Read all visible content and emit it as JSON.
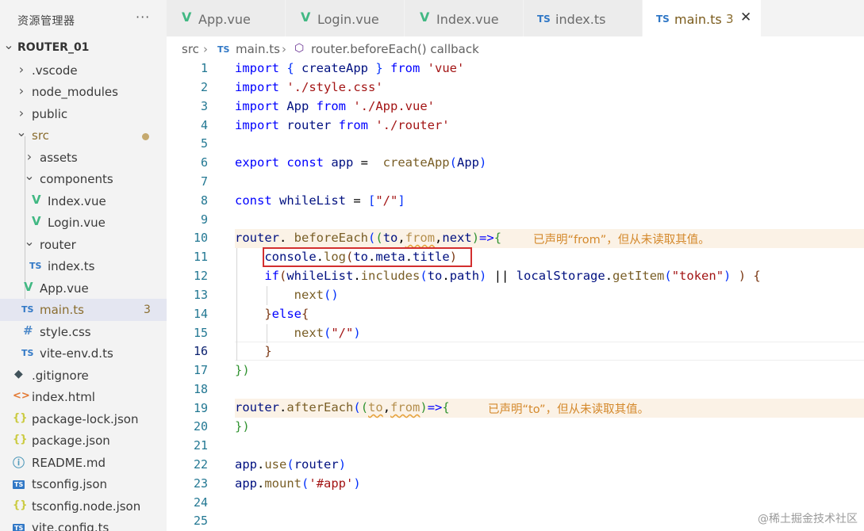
{
  "explorer": {
    "title": "资源管理器",
    "more": "···",
    "items": [
      {
        "label": "ROUTER_01",
        "type": "root"
      },
      {
        "label": ".vscode",
        "type": "folder"
      },
      {
        "label": "node_modules",
        "type": "folder"
      },
      {
        "label": "public",
        "type": "folder"
      },
      {
        "label": "src",
        "type": "folder-open"
      },
      {
        "label": "assets",
        "type": "folder"
      },
      {
        "label": "components",
        "type": "folder-open"
      },
      {
        "label": "Index.vue",
        "type": "vue"
      },
      {
        "label": "Login.vue",
        "type": "vue"
      },
      {
        "label": "router",
        "type": "folder-open"
      },
      {
        "label": "index.ts",
        "type": "ts"
      },
      {
        "label": "App.vue",
        "type": "vue"
      },
      {
        "label": "main.ts",
        "type": "ts",
        "count": "3"
      },
      {
        "label": "style.css",
        "type": "css"
      },
      {
        "label": "vite-env.d.ts",
        "type": "ts"
      },
      {
        "label": ".gitignore",
        "type": "git"
      },
      {
        "label": "index.html",
        "type": "html"
      },
      {
        "label": "package-lock.json",
        "type": "json"
      },
      {
        "label": "package.json",
        "type": "json"
      },
      {
        "label": "README.md",
        "type": "info"
      },
      {
        "label": "tsconfig.json",
        "type": "tsconfig"
      },
      {
        "label": "tsconfig.node.json",
        "type": "json"
      },
      {
        "label": "vite.config.ts",
        "type": "tsconfig"
      }
    ]
  },
  "icons": {
    "chevron_right": "›",
    "chevron_down": "⌄",
    "vue": "V",
    "ts": "TS",
    "css": "#",
    "git": "◆",
    "html": "<>",
    "json": "{}",
    "info": "ⓘ",
    "tsconfig": "TS",
    "close": "✕",
    "function": "⬡"
  },
  "tabs": [
    {
      "label": "App.vue",
      "icon": "vue"
    },
    {
      "label": "Login.vue",
      "icon": "vue"
    },
    {
      "label": "Index.vue",
      "icon": "vue"
    },
    {
      "label": "index.ts",
      "icon": "ts"
    },
    {
      "label": "main.ts",
      "icon": "ts",
      "count": "3",
      "active": true
    }
  ],
  "breadcrumb": {
    "folder": "src",
    "file": "main.ts",
    "symbol": "router.beforeEach() callback"
  },
  "code": {
    "lines": [
      "1",
      "2",
      "3",
      "4",
      "5",
      "6",
      "7",
      "8",
      "9",
      "10",
      "11",
      "12",
      "13",
      "14",
      "15",
      "16",
      "17",
      "18",
      "19",
      "20",
      "21",
      "22",
      "23",
      "24",
      "25"
    ],
    "hint_line10": "已声明“from”，但从未读取其值。",
    "hint_line19": "已声明“to”，但从未读取其值。"
  },
  "status_colors": {
    "warning": "#d4892c",
    "highlight_box": "#d32f2f",
    "keyword": "#0000ff",
    "string": "#a31515"
  },
  "watermark": "@稀土掘金技术社区"
}
